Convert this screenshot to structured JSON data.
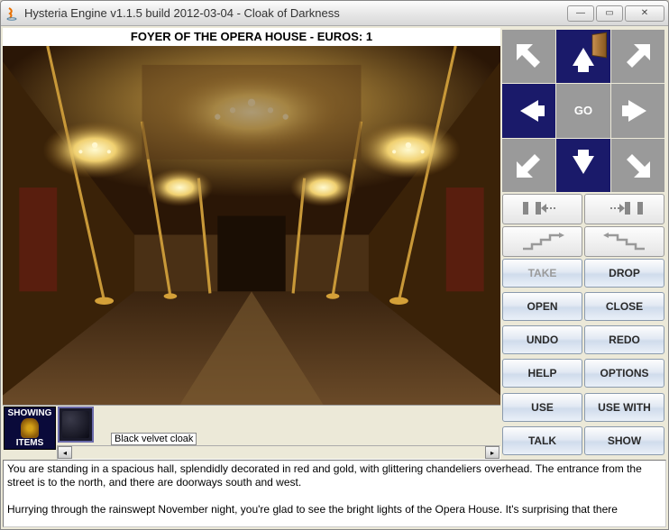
{
  "window": {
    "title": "Hysteria Engine v1.1.5 build 2012-03-04 - Cloak of Darkness"
  },
  "header": {
    "location_status": "FOYER OF THE OPERA HOUSE - EUROS: 1"
  },
  "inventory": {
    "toggle_top": "SHOWING",
    "toggle_bottom": "ITEMS",
    "selected_label": "Black velvet cloak"
  },
  "compass": {
    "go_label": "GO",
    "cells": {
      "nw": {
        "available": false
      },
      "n": {
        "available": true,
        "has_door": true
      },
      "ne": {
        "available": false
      },
      "w": {
        "available": true
      },
      "e": {
        "available": false
      },
      "sw": {
        "available": false
      },
      "s": {
        "available": true
      },
      "se": {
        "available": false
      }
    }
  },
  "actions": {
    "take": "TAKE",
    "drop": "DROP",
    "open": "OPEN",
    "close": "CLOSE",
    "undo": "UNDO",
    "redo": "REDO",
    "help": "HELP",
    "options": "OPTIONS",
    "use": "USE",
    "use_with": "USE WITH",
    "talk": "TALK",
    "show": "SHOW"
  },
  "narrative": {
    "p1": "You are standing in a spacious hall, splendidly decorated in red and gold, with glittering chandeliers overhead. The entrance from the street is to the north, and there are doorways south and west.",
    "p2": "Hurrying through the rainswept November night, you're glad to see the bright lights of the Opera House. It's surprising that there"
  }
}
